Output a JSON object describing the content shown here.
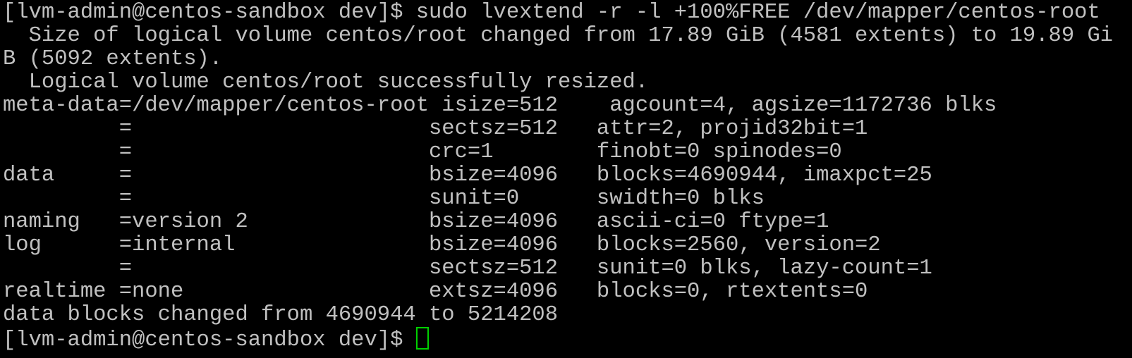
{
  "terminal": {
    "lines": [
      "[lvm-admin@centos-sandbox dev]$ sudo lvextend -r -l +100%FREE /dev/mapper/centos-root",
      "  Size of logical volume centos/root changed from 17.89 GiB (4581 extents) to 19.89 Gi",
      "B (5092 extents).",
      "  Logical volume centos/root successfully resized.",
      "meta-data=/dev/mapper/centos-root isize=512    agcount=4, agsize=1172736 blks",
      "         =                       sectsz=512   attr=2, projid32bit=1",
      "         =                       crc=1        finobt=0 spinodes=0",
      "data     =                       bsize=4096   blocks=4690944, imaxpct=25",
      "         =                       sunit=0      swidth=0 blks",
      "naming   =version 2              bsize=4096   ascii-ci=0 ftype=1",
      "log      =internal               bsize=4096   blocks=2560, version=2",
      "         =                       sectsz=512   sunit=0 blks, lazy-count=1",
      "realtime =none                   extsz=4096   blocks=0, rtextents=0",
      "data blocks changed from 4690944 to 5214208"
    ],
    "prompt": "[lvm-admin@centos-sandbox dev]$ ",
    "colors": {
      "background": "#000000",
      "text": "#c0c0c0",
      "cursor": "#00d000"
    }
  }
}
